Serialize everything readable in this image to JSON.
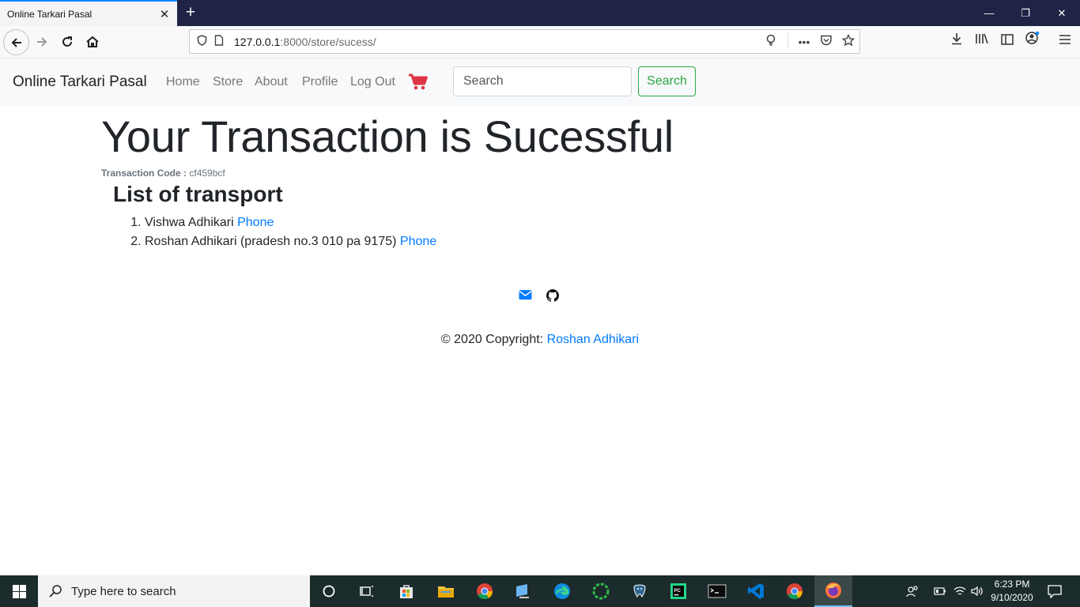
{
  "browser": {
    "tab_title": "Online Tarkari Pasal",
    "tab_close": "✕",
    "new_tab": "+",
    "url_host": "127.0.0.1",
    "url_path": ":8000/store/sucess/",
    "win_min": "—",
    "win_restore": "❐",
    "win_close": "✕"
  },
  "site": {
    "brand": "Online Tarkari Pasal",
    "nav": [
      "Home",
      "Store",
      "About",
      "Profile",
      "Log Out"
    ],
    "search_placeholder": "Search",
    "search_button": "Search",
    "cart_color": "#dc3545"
  },
  "main": {
    "heading": "Your Transaction is Sucessful",
    "transaction_label": "Transaction Code :",
    "transaction_code": "cf459bcf",
    "list_title": "List of transport",
    "transport": [
      {
        "name": "Vishwa Adhikari",
        "link": "Phone"
      },
      {
        "name": "Roshan Adhikari (pradesh no.3 010 pa 9175)",
        "link": "Phone"
      }
    ]
  },
  "footer": {
    "copyright_prefix": "© 2020 Copyright:",
    "copyright_name": "Roshan Adhikari"
  },
  "taskbar": {
    "search_placeholder": "Type here to search",
    "time": "6:23 PM",
    "date": "9/10/2020"
  }
}
